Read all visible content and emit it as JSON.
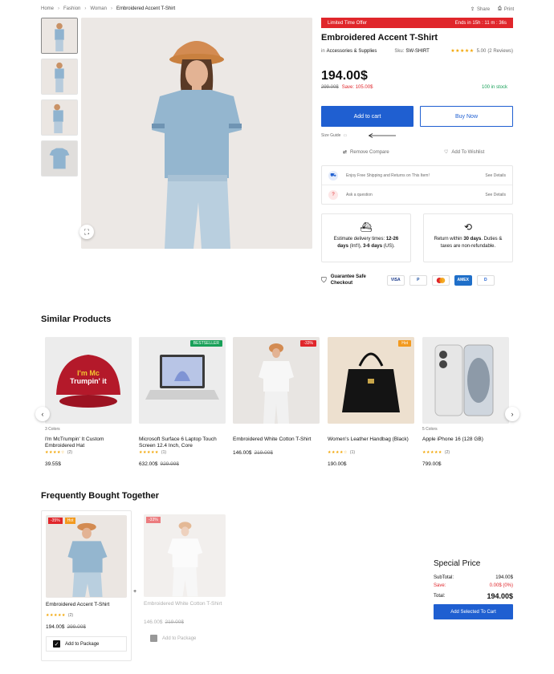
{
  "breadcrumb": [
    "Home",
    "Fashion",
    "Woman",
    "Embroidered Accent T-Shirt"
  ],
  "header_actions": {
    "share": "Share",
    "print": "Print"
  },
  "offer": {
    "label": "Limited Time Offer",
    "timer": "Ends in 15h : 11 m : 36s"
  },
  "product": {
    "title": "Embroidered Accent T-Shirt",
    "in_label": "in",
    "category": "Accessories & Supplies",
    "sku_label": "Sku:",
    "sku": "SW-SHIRT",
    "rating": "5.00",
    "reviews": "(2 Reviews)",
    "price": "194.00$",
    "old_price": "299.00$",
    "save": "Save: 105.00$",
    "stock": "100 in stock",
    "add_to_cart": "Add to cart",
    "buy_now": "Buy Now",
    "size_guide": "Size Guide",
    "remove_compare": "Remove Compare",
    "add_wishlist": "Add To Wishlist",
    "shipping_note": "Enjoy Free Shipping and Returns on This Item!",
    "ask_question": "Ask a question",
    "see_details": "See Details",
    "delivery_pre": "Estimate delivery times: ",
    "delivery_b1": "12-26 days",
    "delivery_mid": " (Int'l), ",
    "delivery_b2": "3-6 days",
    "delivery_post": " (US).",
    "return_pre": "Return within ",
    "return_b": "30 days",
    "return_post": ". Duties & taxes are non-refundable.",
    "guarantee": "Guarantee Safe Checkout",
    "payments": [
      "VISA",
      "P",
      "MC",
      "AMEX",
      "D"
    ]
  },
  "similar": {
    "heading": "Similar Products",
    "items": [
      {
        "name": "I'm McTrumpin' It Custom Embroidered Hat",
        "colors": "3 Colors",
        "reviews": "(2)",
        "price": "39.55$",
        "old": "",
        "badge": "",
        "cap_text": "I'm Mc Trumpin' it"
      },
      {
        "name": "Microsoft Surface 6 Laptop Touch Screen 12.4 Inch, Core",
        "colors": "",
        "reviews": "(1)",
        "price": "632.00$",
        "old": "929.99$",
        "badge": "BESTSELLER"
      },
      {
        "name": "Embroidered White Cotton T-Shirt",
        "colors": "",
        "reviews": "",
        "price": "146.00$",
        "old": "219.00$",
        "badge": "-33%"
      },
      {
        "name": "Women's Leather Handbag (Black)",
        "colors": "",
        "reviews": "(1)",
        "price": "190.00$",
        "old": "",
        "badge": "Hot"
      },
      {
        "name": "Apple iPhone 16 (128 GB)",
        "colors": "5 Colors",
        "reviews": "(2)",
        "price": "799.00$",
        "old": "",
        "badge": ""
      }
    ]
  },
  "fbt": {
    "heading": "Frequently Bought Together",
    "items": [
      {
        "name": "Embroidered Accent T-Shirt",
        "reviews": "(2)",
        "price": "194.00$",
        "old": "299.00$",
        "badge1": "-35%",
        "badge2": "Hot",
        "pkg": "Add to Package"
      },
      {
        "name": "Embroidered White Cotton T-Shirt",
        "reviews": "",
        "price": "146.00$",
        "old": "219.00$",
        "badge1": "-33%",
        "badge2": "",
        "pkg": "Add to Package"
      }
    ],
    "special_title": "Special Price",
    "subtotal_label": "SubTotal:",
    "subtotal": "194.00$",
    "save_label": "Save:",
    "save": "0.00$ (0%)",
    "total_label": "Total:",
    "total": "194.00$",
    "cta": "Add Selected To Cart"
  },
  "colors": {
    "accent": "#1f5fd1",
    "sale": "#e0262b",
    "stock": "#18a058",
    "star": "#f2a400"
  }
}
